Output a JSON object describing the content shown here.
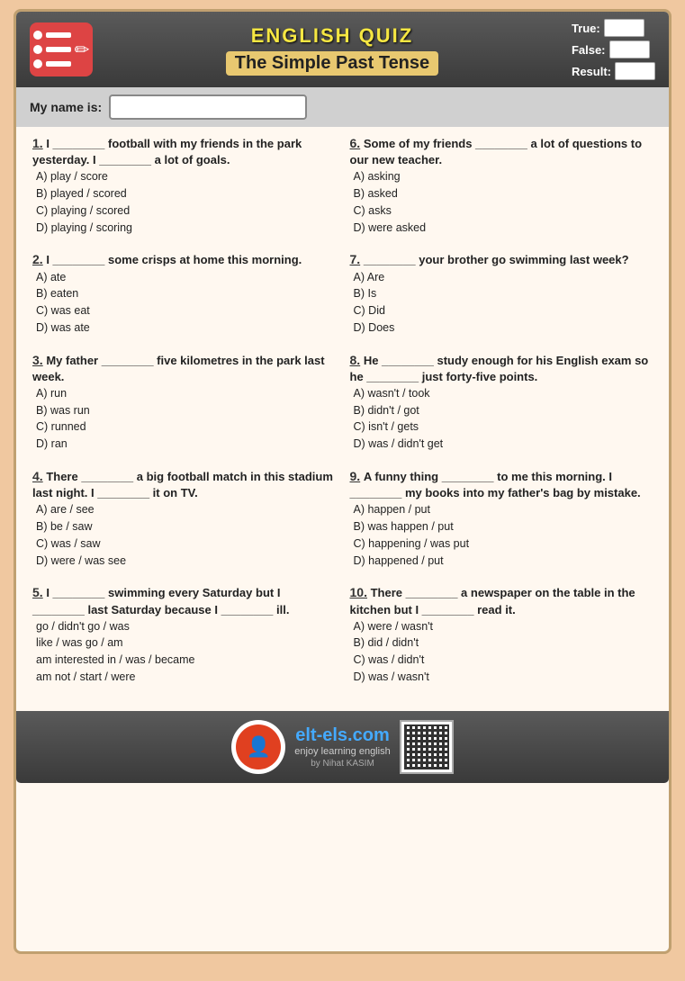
{
  "header": {
    "quiz_title": "ENGLISH QUIZ",
    "quiz_subtitle": "The Simple Past Tense",
    "name_label": "My name is:",
    "true_label": "True:",
    "false_label": "False:",
    "result_label": "Result:"
  },
  "questions": [
    {
      "number": "1.",
      "text": "I ________ football with my friends in the park yesterday. I ________ a lot of goals.",
      "options": [
        "A) play / score",
        "B) played / scored",
        "C) playing / scored",
        "D) playing / scoring"
      ]
    },
    {
      "number": "2.",
      "text": "I ________ some crisps at home this morning.",
      "options": [
        "A) ate",
        "B) eaten",
        "C) was eat",
        "D) was ate"
      ]
    },
    {
      "number": "3.",
      "text": "My father ________ five kilometres in the park last week.",
      "options": [
        "A) run",
        "B) was run",
        "C) runned",
        "D) ran"
      ]
    },
    {
      "number": "4.",
      "text": "There ________ a big football match in this stadium last night. I ________ it on TV.",
      "options": [
        "A) are / see",
        "B) be / saw",
        "C) was / saw",
        "D) were / was see"
      ]
    },
    {
      "number": "5.",
      "text": "I ________ swimming every Saturday but I ________ last Saturday because I ________ ill.",
      "options": [
        "go / didn't go / was",
        "like / was go / am",
        "am interested in / was / became",
        "am not / start / were"
      ]
    },
    {
      "number": "6.",
      "text": "Some of my friends ________ a lot of questions to our new teacher.",
      "options": [
        "A) asking",
        "B) asked",
        "C) asks",
        "D) were asked"
      ]
    },
    {
      "number": "7.",
      "text": "________ your brother go swimming last week?",
      "options": [
        "A) Are",
        "B) Is",
        "C) Did",
        "D) Does"
      ]
    },
    {
      "number": "8.",
      "text": "He ________ study enough for his English exam so he ________ just forty-five points.",
      "options": [
        "A) wasn't / took",
        "B) didn't / got",
        "C) isn't / gets",
        "D) was / didn't get"
      ]
    },
    {
      "number": "9.",
      "text": "A funny thing ________ to me this morning. I ________ my books into my father's bag by mistake.",
      "options": [
        "A) happen / put",
        "B) was happen / put",
        "C) happening / was put",
        "D) happened / put"
      ]
    },
    {
      "number": "10.",
      "text": "There ________ a newspaper on the table in the kitchen but I ________ read it.",
      "options": [
        "A) were / wasn't",
        "B) did / didn't",
        "C) was / didn't",
        "D) was / wasn't"
      ]
    }
  ],
  "footer": {
    "site": "elt-els.com",
    "tagline": "enjoy learning english",
    "author": "by Nihat KASIM"
  }
}
